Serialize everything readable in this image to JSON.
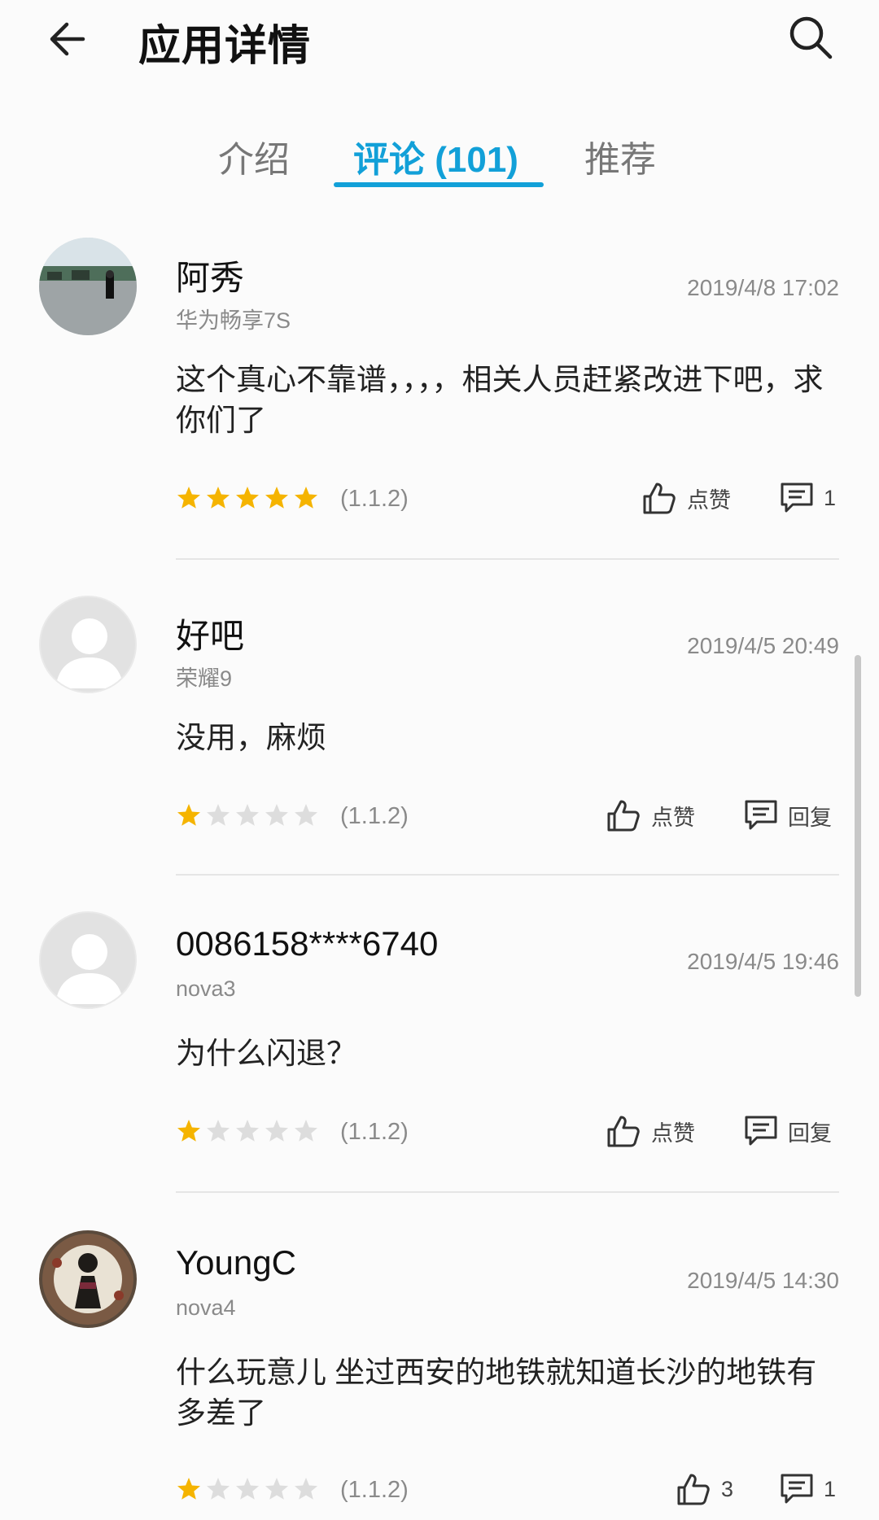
{
  "header": {
    "title": "应用详情",
    "back_icon": "arrow-left-icon",
    "search_icon": "search-icon"
  },
  "tabs": [
    {
      "label": "介绍",
      "active": false
    },
    {
      "label": "评论 (101)",
      "active": true
    },
    {
      "label": "推荐",
      "active": false
    }
  ],
  "colors": {
    "accent": "#12a0d8",
    "star_filled": "#f5b400",
    "star_empty": "#dddddd"
  },
  "reviews": [
    {
      "user": "阿秀",
      "device": "华为畅享7S",
      "date": "2019/4/8 17:02",
      "content": "这个真心不靠谱，，，，相关人员赶紧改进下吧，求你们了",
      "rating": 5,
      "version": "(1.1.2)",
      "like_label": "点赞",
      "reply_label": "1"
    },
    {
      "user": "好吧",
      "device": "荣耀9",
      "date": "2019/4/5 20:49",
      "content": "没用，麻烦",
      "rating": 1,
      "version": "(1.1.2)",
      "like_label": "点赞",
      "reply_label": "回复"
    },
    {
      "user": "0086158****6740",
      "device": "nova3",
      "date": "2019/4/5 19:46",
      "content": "为什么闪退？",
      "rating": 1,
      "version": "(1.1.2)",
      "like_label": "点赞",
      "reply_label": "回复"
    },
    {
      "user": "YoungC",
      "device": "nova4",
      "date": "2019/4/5 14:30",
      "content": "什么玩意儿 坐过西安的地铁就知道长沙的地铁有多差了",
      "rating": 1,
      "version": "(1.1.2)",
      "like_label": "3",
      "reply_label": "1"
    }
  ]
}
